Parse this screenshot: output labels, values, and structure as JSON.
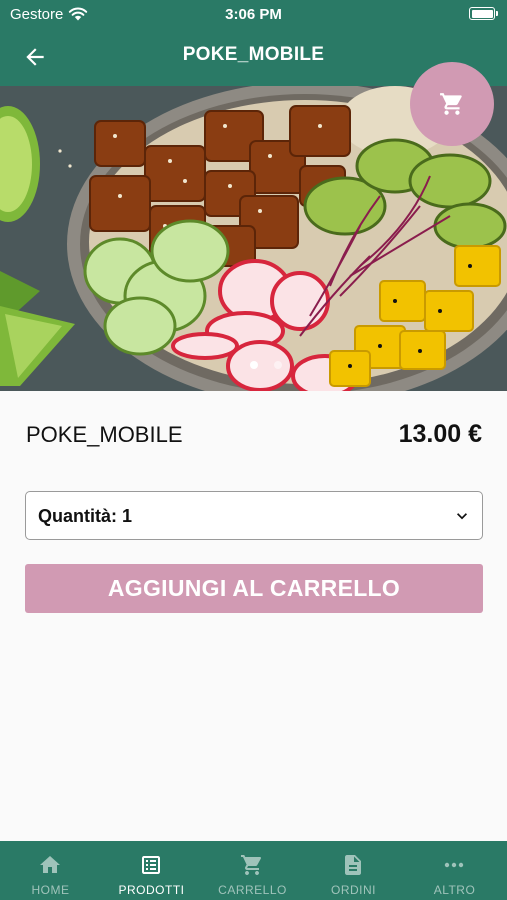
{
  "status_bar": {
    "carrier": "Gestore",
    "time": "3:06 PM"
  },
  "app_bar": {
    "title": "POKE_MOBILE"
  },
  "hero": {
    "image_alt": "poke bowl",
    "slide_count": 2,
    "active_slide": 1
  },
  "product": {
    "name": "POKE_MOBILE",
    "price": "13.00 €"
  },
  "quantity": {
    "label": "Quantità: 1"
  },
  "add_button": {
    "label": "AGGIUNGI AL CARRELLO"
  },
  "bottom_nav": {
    "items": [
      {
        "label": "HOME",
        "icon": "home-icon"
      },
      {
        "label": "PRODOTTI",
        "icon": "list-icon",
        "active": true
      },
      {
        "label": "CARRELLO",
        "icon": "cart-icon"
      },
      {
        "label": "ORDINI",
        "icon": "document-icon"
      },
      {
        "label": "ALTRO",
        "icon": "more-icon"
      }
    ]
  },
  "colors": {
    "primary": "#2a7a66",
    "accent": "#d19ab3",
    "background": "#fafafa"
  }
}
